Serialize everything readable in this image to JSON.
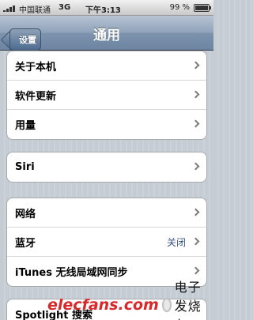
{
  "status": {
    "carrier": "中国联通",
    "network": "3G",
    "time": "下午3:13",
    "battery": "99 %"
  },
  "nav": {
    "back_label": "设置",
    "title": "通用"
  },
  "group1": [
    {
      "label": "关于本机"
    },
    {
      "label": "软件更新"
    },
    {
      "label": "用量"
    }
  ],
  "group2": [
    {
      "label": "Siri"
    }
  ],
  "group3": [
    {
      "label": "网络"
    },
    {
      "label": "蓝牙",
      "value": "关闭"
    },
    {
      "label": "iTunes 无线局域网同步"
    }
  ],
  "group4": [
    {
      "label": "Spotlight 搜索"
    }
  ],
  "watermark": {
    "logo": "elecfans.com",
    "cn": "电子发烧友"
  },
  "colors": {
    "nav_bar": "#6d85a3",
    "background": "#c5ccd4",
    "value_text": "#385487"
  }
}
